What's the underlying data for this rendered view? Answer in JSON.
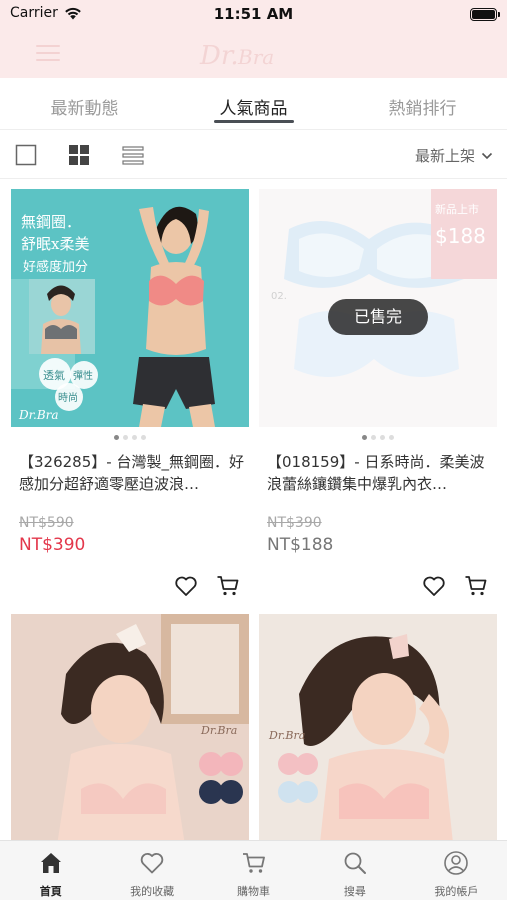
{
  "status_bar": {
    "carrier": "Carrier",
    "time": "11:51 AM"
  },
  "navbar": {
    "logo_text": "Dr.Bra"
  },
  "tabs": [
    {
      "label": "最新動態"
    },
    {
      "label": "人氣商品",
      "active": true
    },
    {
      "label": "熱銷排行"
    }
  ],
  "toolbar": {
    "sort_label": "最新上架"
  },
  "products": [
    {
      "title": "【326285】- 台灣製_無鋼圈．好感加分超舒適零壓迫波浪…",
      "original_price": "NT$590",
      "price": "NT$390",
      "price_color": "#e3374b",
      "sold_out": false,
      "image_text": {
        "line1": "無鋼圈．",
        "line2": "舒眠x柔美",
        "line3": "好感度加分",
        "badge1": "透氣",
        "badge2": "時尚",
        "badge3": "彈性",
        "brand": "Dr.Bra"
      }
    },
    {
      "title": "【018159】- 日系時尚．柔美波浪蕾絲鑲鑽集中爆乳內衣…",
      "original_price": "NT$390",
      "price": "NT$188",
      "price_color": "#777777",
      "sold_out": true,
      "sold_out_label": "已售完",
      "image_text": {
        "tag": "新品上市",
        "price": "$188",
        "label": "02."
      }
    },
    {
      "title": "",
      "image_text": {
        "brand": "Dr.Bra"
      }
    },
    {
      "title": "",
      "image_text": {
        "brand": "Dr.Bra"
      }
    }
  ],
  "bottom_tabs": [
    {
      "label": "首頁",
      "icon": "home-icon",
      "active": true
    },
    {
      "label": "我的收藏",
      "icon": "heart-icon"
    },
    {
      "label": "購物車",
      "icon": "cart-icon"
    },
    {
      "label": "搜尋",
      "icon": "search-icon"
    },
    {
      "label": "我的帳戶",
      "icon": "account-icon"
    }
  ],
  "colors": {
    "header_bg": "#fbeaea",
    "sale_red": "#e3374b",
    "tab_underline": "#4a4f55"
  }
}
